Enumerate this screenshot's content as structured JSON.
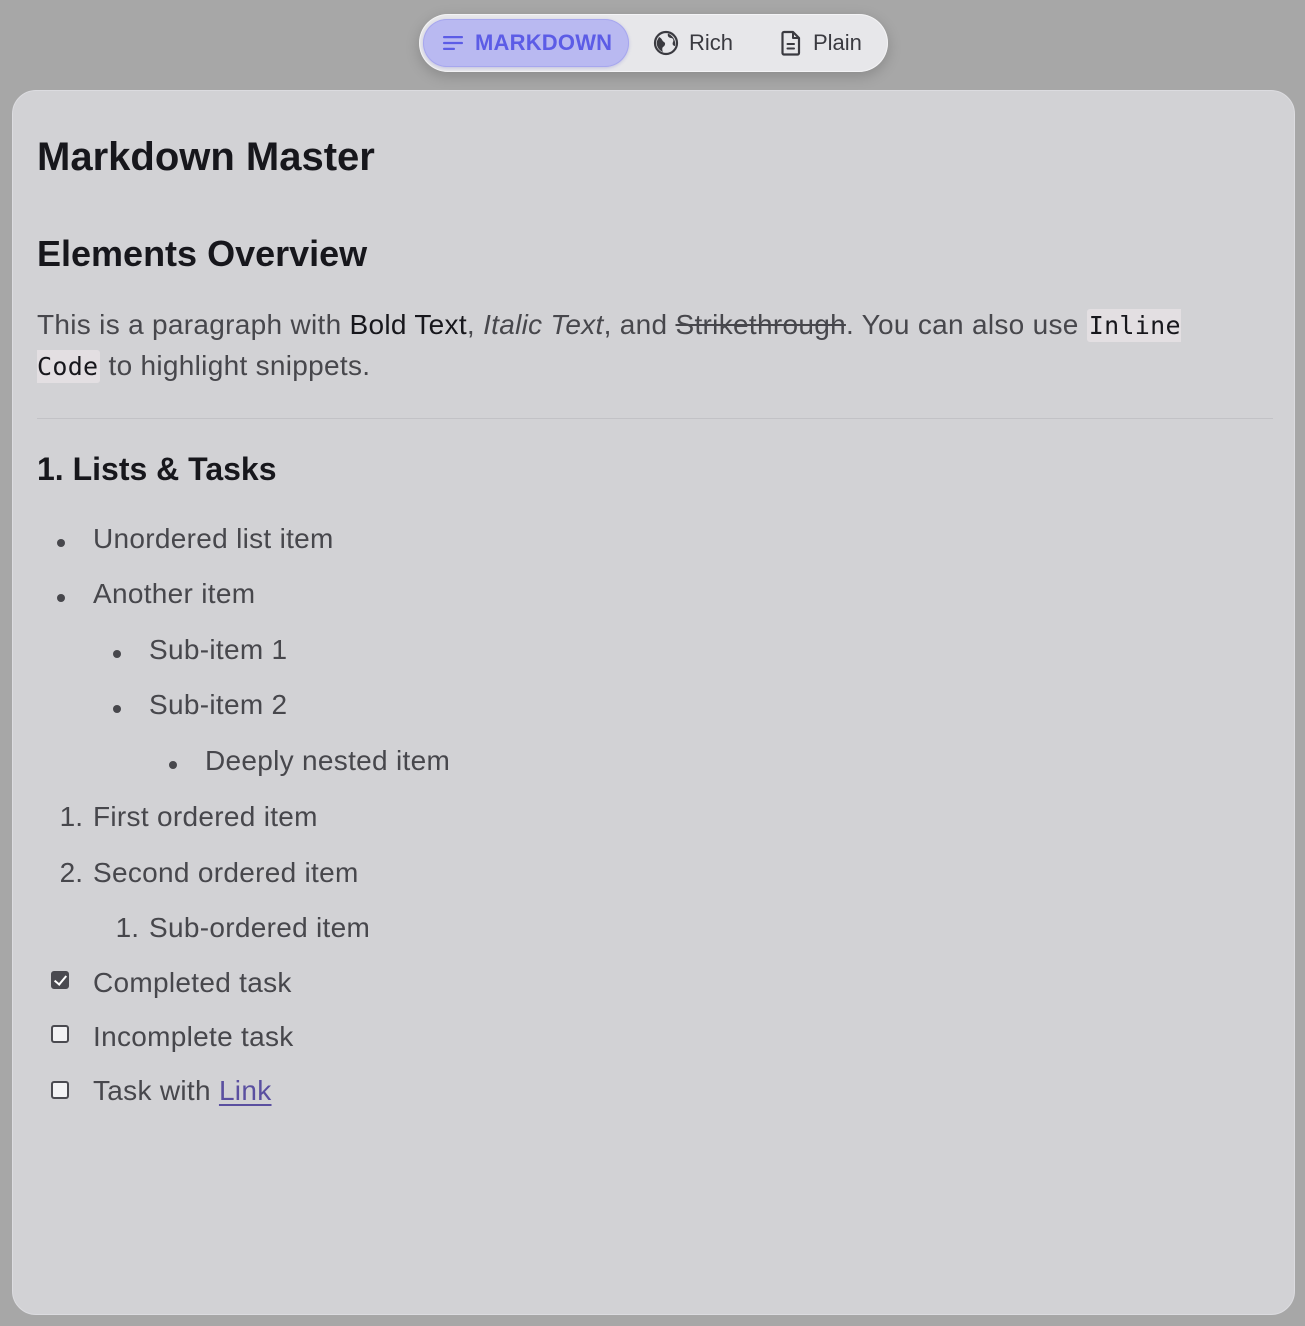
{
  "mode_switcher": {
    "markdown_label": "MARKDOWN",
    "rich_label": "Rich",
    "plain_label": "Plain",
    "active": "markdown"
  },
  "document": {
    "title": "Markdown Master",
    "section_heading": "Elements Overview",
    "paragraph": {
      "text_1": "This is a paragraph with ",
      "bold": "Bold Text",
      "text_2": ", ",
      "italic": "Italic Text",
      "text_3": ", and ",
      "strike": "Strikethrough",
      "text_4": ". You can also use ",
      "code": "Inline Code",
      "text_5": " to highlight snippets."
    },
    "lists_heading": "1. Lists & Tasks",
    "unordered": [
      "Unordered list item",
      "Another item",
      "Sub-item 1",
      "Sub-item 2",
      "Deeply nested item"
    ],
    "ordered": [
      {
        "marker": "1.",
        "text": "First ordered item"
      },
      {
        "marker": "2.",
        "text": "Second ordered item"
      },
      {
        "marker": "1.",
        "text": "Sub-ordered item"
      }
    ],
    "tasks": [
      {
        "text": "Completed task",
        "checked": true
      },
      {
        "text": "Incomplete task",
        "checked": false
      },
      {
        "text": "Task with ",
        "link": "Link",
        "checked": false
      }
    ]
  },
  "colors": {
    "accent": "#5c5ce6",
    "link": "#5a4fa0",
    "card_background": "#d2d2d5"
  }
}
